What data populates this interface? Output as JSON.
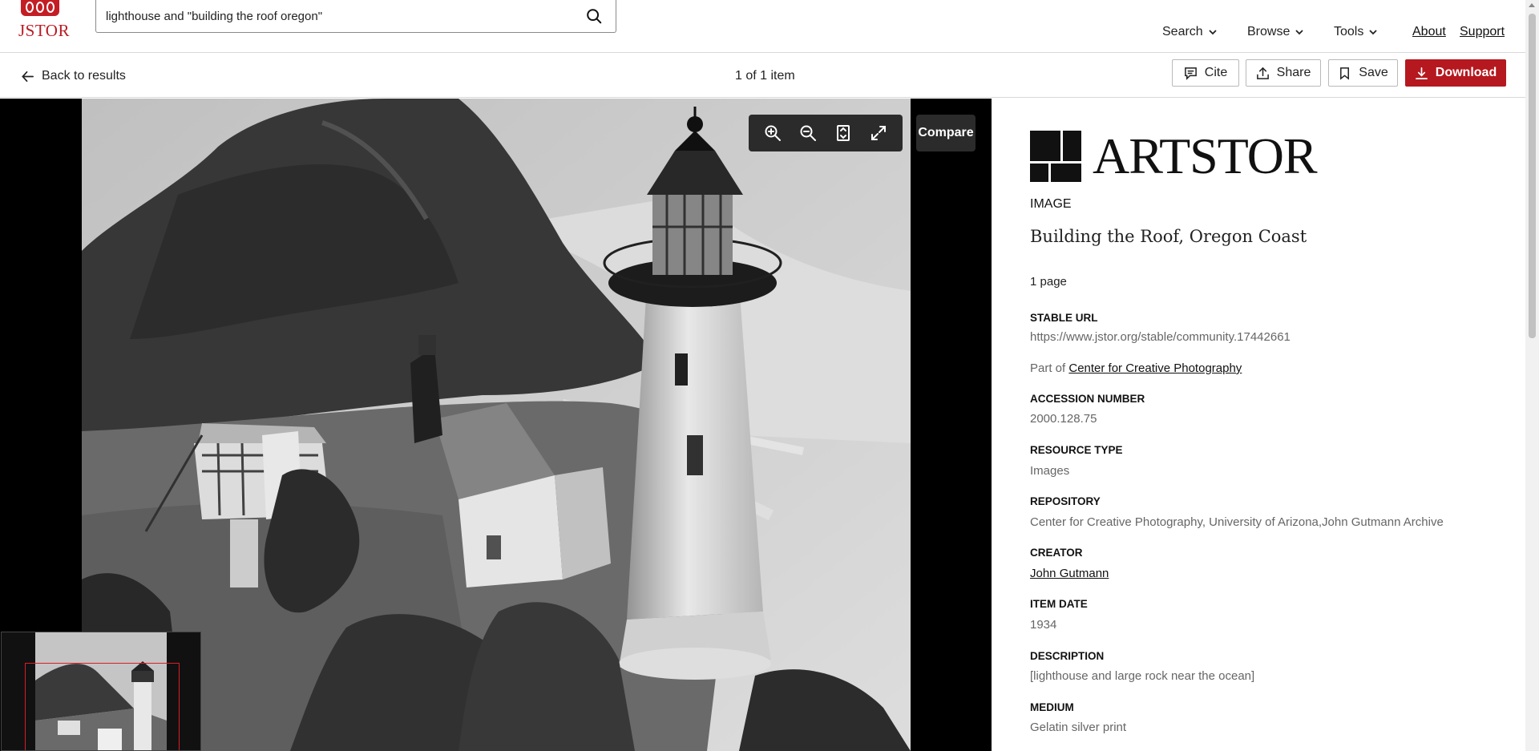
{
  "header": {
    "logo_text": "JSTOR",
    "search": {
      "value": "lighthouse and \"building the roof oregon\"",
      "placeholder": ""
    },
    "nav": [
      {
        "label": "Search"
      },
      {
        "label": "Browse"
      },
      {
        "label": "Tools"
      }
    ],
    "links": {
      "about": "About",
      "support": "Support"
    }
  },
  "subbar": {
    "back_label": "Back to results",
    "count": "1 of 1 item",
    "actions": {
      "cite": "Cite",
      "share": "Share",
      "save": "Save",
      "download": "Download"
    }
  },
  "viewer": {
    "compare_label": "Compare",
    "tools": [
      "zoom-in-icon",
      "zoom-out-icon",
      "fit-icon",
      "fullscreen-icon"
    ]
  },
  "details": {
    "brand": "ARTSTOR",
    "type": "IMAGE",
    "title": "Building the Roof, Oregon Coast",
    "pages": "1 page",
    "stable_url_label": "STABLE URL",
    "stable_url": "https://www.jstor.org/stable/community.17442661",
    "part_of_prefix": "Part of",
    "part_of_link": "Center for Creative Photography",
    "accession_label": "ACCESSION NUMBER",
    "accession": "2000.128.75",
    "resource_type_label": "RESOURCE TYPE",
    "resource_type": "Images",
    "repository_label": "REPOSITORY",
    "repository": "Center for Creative Photography, University of Arizona,John Gutmann Archive",
    "creator_label": "CREATOR",
    "creator": "John Gutmann",
    "item_date_label": "ITEM DATE",
    "item_date": "1934",
    "description_label": "DESCRIPTION",
    "description": "[lighthouse and large rock near the ocean]",
    "medium_label": "MEDIUM",
    "medium": "Gelatin silver print"
  },
  "colors": {
    "brand_red": "#b5181f",
    "viewer_bg": "#000000"
  }
}
